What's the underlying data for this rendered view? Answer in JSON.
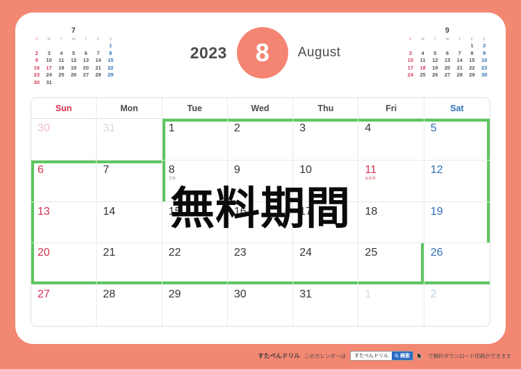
{
  "theme": {
    "background": "#F28772",
    "card": "#ffffff",
    "accent": "#F58573",
    "highlight_green": "#5CC75F",
    "sunday_red": "#D2304F",
    "saturday_blue": "#2E6FB8",
    "weekday_gray": "#333333"
  },
  "header": {
    "year": "2023",
    "month_number": "8",
    "month_name": "August"
  },
  "mini_prev": {
    "title": "7",
    "dow": [
      "S",
      "M",
      "T",
      "W",
      "T",
      "F",
      "S"
    ],
    "weeks": [
      [
        "",
        "",
        "",
        "",
        "",
        "",
        "1"
      ],
      [
        "2",
        "3",
        "4",
        "5",
        "6",
        "7",
        "8"
      ],
      [
        "9",
        "10",
        "11",
        "12",
        "13",
        "14",
        "15"
      ],
      [
        "16",
        "17",
        "18",
        "19",
        "20",
        "21",
        "22"
      ],
      [
        "23",
        "24",
        "25",
        "26",
        "27",
        "28",
        "29"
      ],
      [
        "30",
        "31",
        "",
        "",
        "",
        "",
        ""
      ]
    ],
    "holidays": [
      "17"
    ]
  },
  "mini_next": {
    "title": "9",
    "dow": [
      "S",
      "M",
      "T",
      "W",
      "T",
      "F",
      "S"
    ],
    "weeks": [
      [
        "",
        "",
        "",
        "",
        "",
        "1",
        "2"
      ],
      [
        "3",
        "4",
        "5",
        "6",
        "7",
        "8",
        "9"
      ],
      [
        "10",
        "11",
        "12",
        "13",
        "14",
        "15",
        "16"
      ],
      [
        "17",
        "18",
        "19",
        "20",
        "21",
        "22",
        "23"
      ],
      [
        "24",
        "25",
        "26",
        "27",
        "28",
        "29",
        "30"
      ]
    ],
    "holidays": [
      "18"
    ]
  },
  "main_calendar": {
    "dow_headers": [
      "Sun",
      "Mon",
      "Tue",
      "Wed",
      "Thu",
      "Fri",
      "Sat"
    ],
    "weeks": [
      [
        {
          "n": "30",
          "out": true
        },
        {
          "n": "31",
          "out": true
        },
        {
          "n": "1"
        },
        {
          "n": "2"
        },
        {
          "n": "3"
        },
        {
          "n": "4"
        },
        {
          "n": "5"
        }
      ],
      [
        {
          "n": "6"
        },
        {
          "n": "7"
        },
        {
          "n": "8",
          "note": "立秋"
        },
        {
          "n": "9"
        },
        {
          "n": "10"
        },
        {
          "n": "11",
          "note": "山の日",
          "holiday": true
        },
        {
          "n": "12"
        }
      ],
      [
        {
          "n": "13"
        },
        {
          "n": "14"
        },
        {
          "n": "15"
        },
        {
          "n": "16"
        },
        {
          "n": "17"
        },
        {
          "n": "18"
        },
        {
          "n": "19"
        }
      ],
      [
        {
          "n": "20"
        },
        {
          "n": "21"
        },
        {
          "n": "22"
        },
        {
          "n": "23"
        },
        {
          "n": "24"
        },
        {
          "n": "25"
        },
        {
          "n": "26"
        }
      ],
      [
        {
          "n": "27"
        },
        {
          "n": "28"
        },
        {
          "n": "29"
        },
        {
          "n": "30"
        },
        {
          "n": "31"
        },
        {
          "n": "1",
          "out": true
        },
        {
          "n": "2",
          "out": true
        }
      ]
    ]
  },
  "overlay": {
    "stamp_text": "無料期間"
  },
  "footer": {
    "brand": "すたぺんドリル",
    "text_before": "このカレンダーは",
    "search_value": "すたぺんドリル",
    "search_button": "検索",
    "text_after": "で無料ダウンロード印刷ができます"
  }
}
